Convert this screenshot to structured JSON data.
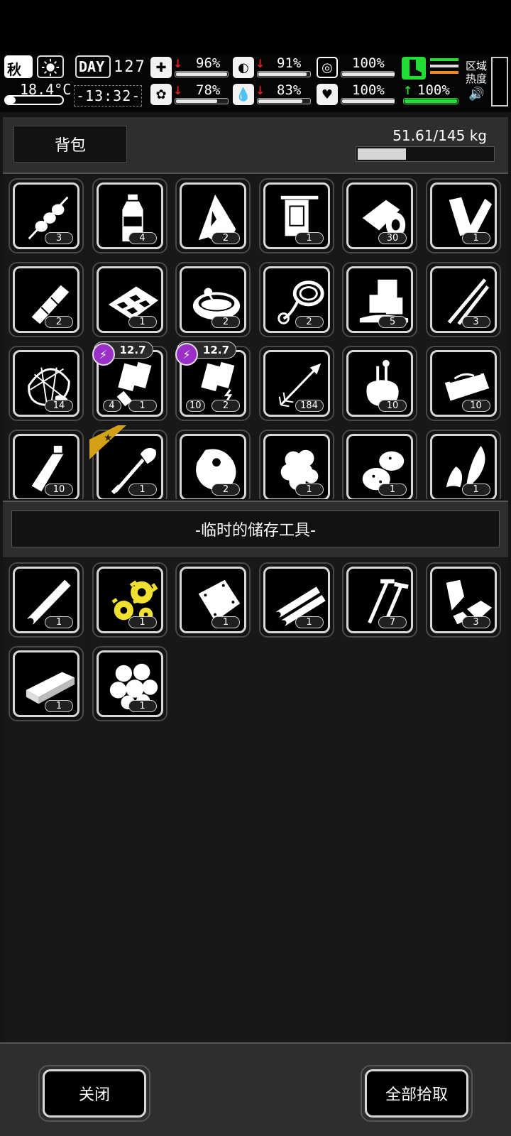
{
  "hud": {
    "season": "秋",
    "temperature": "18.4°C",
    "day_label": "DAY",
    "day_number": "127",
    "clock": "-13:32-",
    "stats": {
      "health": {
        "value": "96%",
        "level": 96
      },
      "stomach": {
        "value": "91%",
        "level": 91
      },
      "stamina": {
        "value": "100%",
        "level": 100
      },
      "brain": {
        "value": "78%",
        "level": 78
      },
      "water": {
        "value": "83%",
        "level": 83
      },
      "heart": {
        "value": "100%",
        "level": 100
      },
      "speed": {
        "value": "100%",
        "level": 100
      }
    },
    "region_heat": "区域\n热度",
    "colors": {
      "arrow_down": "#e02020",
      "arrow_up": "#22dd33",
      "boot": "#22dd33",
      "ammo_purple": "#9a30c8",
      "star_gold": "#d4a017"
    }
  },
  "backpack": {
    "title": "背包",
    "weight_text": "51.61/145 kg",
    "weight_fraction": 0.356,
    "items": [
      {
        "icon": "skewer-icon",
        "count": "3"
      },
      {
        "icon": "bottle-icon",
        "count": "4"
      },
      {
        "icon": "torn-cloth-icon",
        "count": "2"
      },
      {
        "icon": "towel-icon",
        "count": "1"
      },
      {
        "icon": "bandage-roll-icon",
        "count": "30"
      },
      {
        "icon": "fabric-roll-icon",
        "count": "1"
      },
      {
        "icon": "rolled-cloth-icon",
        "count": "2"
      },
      {
        "icon": "tray-icon",
        "count": "1"
      },
      {
        "icon": "bowl-icon",
        "count": "2"
      },
      {
        "icon": "rope-icon",
        "count": "2"
      },
      {
        "icon": "ice-cubes-icon",
        "count": "5"
      },
      {
        "icon": "tweezers-icon",
        "count": "3"
      },
      {
        "icon": "fishing-net-icon",
        "count": "14"
      },
      {
        "icon": "battery-pack-icon",
        "count": "1",
        "count_left": "4",
        "badge": "12.7"
      },
      {
        "icon": "battery-pack-charged-icon",
        "count": "2",
        "count_left": "10",
        "badge": "12.7"
      },
      {
        "icon": "arrow-icon",
        "count": "184"
      },
      {
        "icon": "sack-tools-icon",
        "count": "10"
      },
      {
        "icon": "toolbox-icon",
        "count": "10"
      },
      {
        "icon": "milk-bottle-icon",
        "count": "10"
      },
      {
        "icon": "shovel-icon",
        "count": "1",
        "starred": true
      },
      {
        "icon": "meat-icon",
        "count": "2"
      },
      {
        "icon": "cotton-icon",
        "count": "1"
      },
      {
        "icon": "potatoes-icon",
        "count": "1"
      },
      {
        "icon": "feathers-icon",
        "count": "1"
      }
    ]
  },
  "storage": {
    "title": "-临时的储存工具-",
    "items": [
      {
        "icon": "pipe-icon",
        "count": "1"
      },
      {
        "icon": "gears-icon",
        "count": "1"
      },
      {
        "icon": "metal-sheet-icon",
        "count": "1"
      },
      {
        "icon": "metal-tubes-icon",
        "count": "1"
      },
      {
        "icon": "screws-icon",
        "count": "7"
      },
      {
        "icon": "scrap-metal-icon",
        "count": "3"
      },
      {
        "icon": "plank-icon",
        "count": "1"
      },
      {
        "icon": "cotton-balls-icon",
        "count": "1"
      }
    ]
  },
  "footer": {
    "close_label": "关闭",
    "take_all_label": "全部拾取"
  }
}
